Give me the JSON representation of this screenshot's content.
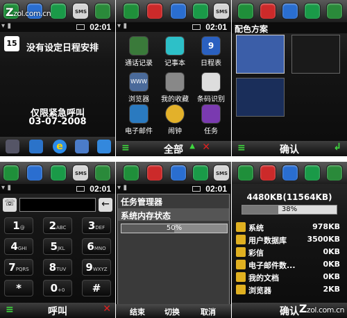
{
  "watermark": {
    "logo": "zol.com.cn",
    "prefix": "Z"
  },
  "status_time": "02:01",
  "panel1": {
    "date_badge": "15",
    "no_schedule": "没有设定日程安排",
    "emergency": "仅限紧急呼叫",
    "date": "03-07-2008"
  },
  "panel2": {
    "apps": [
      "通话记录",
      "记事本",
      "日程表",
      "浏览器",
      "我的收藏",
      "条码识别",
      "电子邮件",
      "闹钟",
      "任务"
    ],
    "calendar_day": "9",
    "www": "WWW",
    "soft_center": "全部"
  },
  "panel3": {
    "title": "配色方案",
    "soft_center": "确认"
  },
  "panel4": {
    "keys": [
      {
        "d": "1",
        "s": "@"
      },
      {
        "d": "2",
        "s": "ABC"
      },
      {
        "d": "3",
        "s": "DEF"
      },
      {
        "d": "4",
        "s": "GHI"
      },
      {
        "d": "5",
        "s": "JKL"
      },
      {
        "d": "6",
        "s": "MNO"
      },
      {
        "d": "7",
        "s": "PQRS"
      },
      {
        "d": "8",
        "s": "TUV"
      },
      {
        "d": "9",
        "s": "WXYZ"
      },
      {
        "d": "*",
        "s": ""
      },
      {
        "d": "0",
        "s": "+0"
      },
      {
        "d": "#",
        "s": ""
      }
    ],
    "soft_center": "呼叫"
  },
  "panel5": {
    "header": "任务管理器",
    "subheader": "系统内存状态",
    "progress_label": "50%",
    "progress": 0.5,
    "buttons": [
      "结束",
      "切换",
      "取消"
    ]
  },
  "panel6": {
    "summary": "4480KB(11564KB)",
    "progress_label": "38%",
    "progress": 0.38,
    "rows": [
      {
        "name": "系统",
        "size": "978KB"
      },
      {
        "name": "用户数据库",
        "size": "3500KB"
      },
      {
        "name": "彩信",
        "size": "0KB"
      },
      {
        "name": "电子邮件数...",
        "size": "0KB"
      },
      {
        "name": "我的文档",
        "size": "0KB"
      },
      {
        "name": "浏览器",
        "size": "2KB"
      }
    ],
    "soft_center": "确认"
  },
  "top_icons": [
    {
      "name": "phone-icon",
      "color": "#1f8f3a",
      "label": ""
    },
    {
      "name": "contacts-icon",
      "color": "#cc2a2a",
      "label": ""
    },
    {
      "name": "people-icon",
      "color": "#2a6ed0",
      "label": ""
    },
    {
      "name": "transfer-icon",
      "color": "#1a9a48",
      "label": ""
    },
    {
      "name": "sms-icon",
      "color": "#d5d5d5",
      "label": "SMS"
    },
    {
      "name": "settings-icon",
      "color": "#2a8a3a",
      "label": ""
    }
  ]
}
